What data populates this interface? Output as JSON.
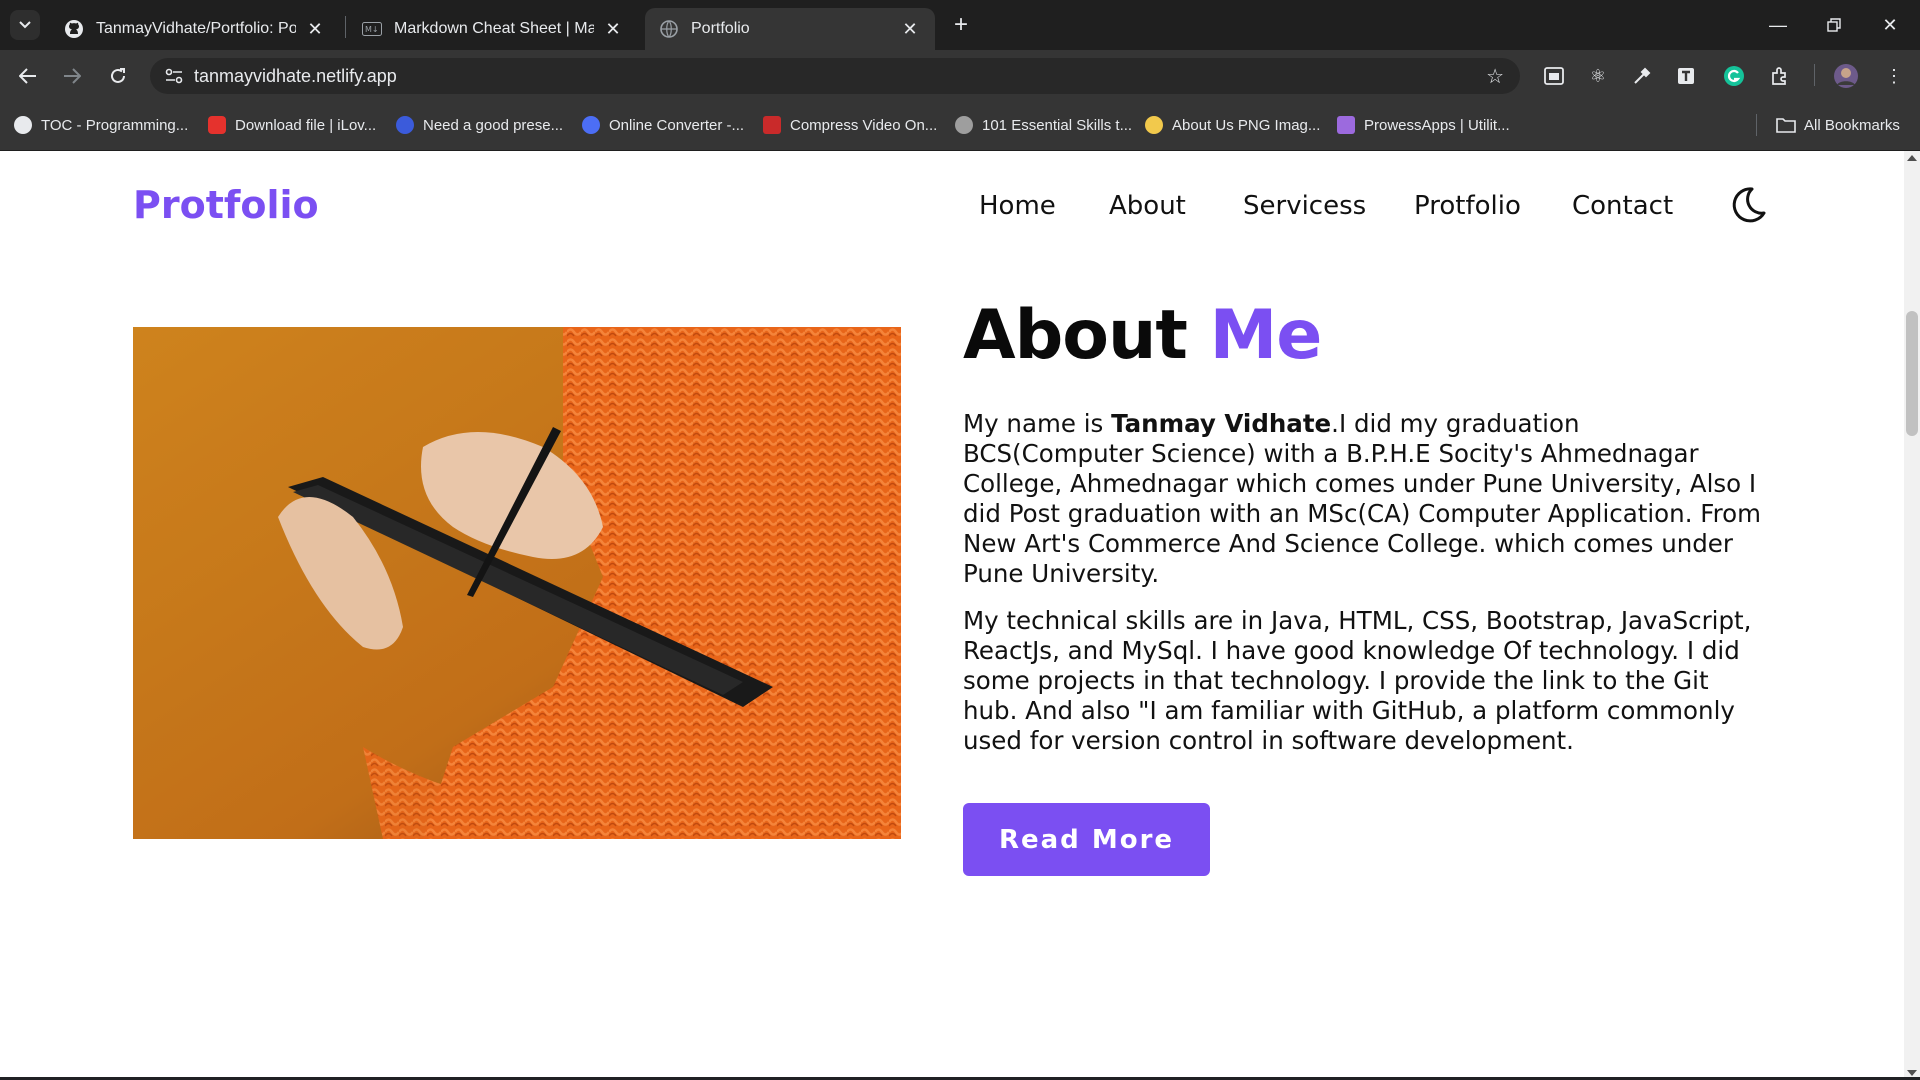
{
  "browser": {
    "tabs": [
      {
        "label": "TanmayVidhate/Portfolio: Portfo",
        "icon": "github-icon"
      },
      {
        "label": "Markdown Cheat Sheet | Markd",
        "icon": "markdown-icon"
      },
      {
        "label": "Portfolio",
        "icon": "globe-icon",
        "active": true
      }
    ],
    "url": "tanmayvidhate.netlify.app",
    "bookmarks": [
      {
        "label": "TOC - Programming...",
        "color": "#e8eaed"
      },
      {
        "label": "Download file | iLov...",
        "color": "#e5322d"
      },
      {
        "label": "Need a good prese...",
        "color": "#3b5bdb"
      },
      {
        "label": "Online Converter -...",
        "color": "#4c6ef5"
      },
      {
        "label": "Compress Video On...",
        "color": "#c92a2a"
      },
      {
        "label": "101 Essential Skills t...",
        "color": "#9e9e9e"
      },
      {
        "label": "About Us PNG Imag...",
        "color": "#f2c94c"
      },
      {
        "label": "ProwessApps | Utilit...",
        "color": "#9c6ade"
      }
    ],
    "all_bookmarks_label": "All Bookmarks"
  },
  "site": {
    "logo": "Protfolio",
    "nav": [
      "Home",
      "About",
      "Servicess",
      "Protfolio",
      "Contact"
    ],
    "about": {
      "title_main": "About",
      "title_accent": "Me",
      "p1_prefix": "My name is ",
      "p1_name": "Tanmay Vidhate",
      "p1_rest": ".I did my graduation BCS(Computer Science) with a B.P.H.E Socity's Ahmednagar College, Ahmednagar which comes under Pune University, Also I did Post graduation with an MSc(CA) Computer Application. From New Art's Commerce And Science College. which comes under Pune University.",
      "p2": "My technical skills are in Java, HTML, CSS, Bootstrap, JavaScript, ReactJs, and MySql. I have good knowledge Of technology. I did some projects in that technology. I provide the link to the Git hub. And also \"I am familiar with GitHub, a platform commonly used for version control in software development.",
      "button": "Read More"
    }
  },
  "colors": {
    "accent": "#7b4ff2"
  }
}
